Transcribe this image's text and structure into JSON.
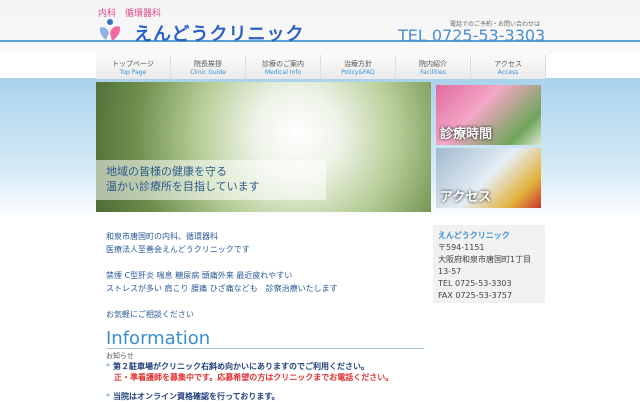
{
  "header": {
    "subtitle": "内科　循環器科",
    "clinic_name": "えんどうクリニック",
    "tel_note": "電話でのご予約・お問い合わせは",
    "tel": "TEL 0725-53-3303"
  },
  "nav": [
    {
      "ja": "トップページ",
      "en": "Top Page"
    },
    {
      "ja": "院長挨拶",
      "en": "Clinic Guide"
    },
    {
      "ja": "診療のご案内",
      "en": "Medical Info"
    },
    {
      "ja": "治療方針",
      "en": "Policy&FAQ"
    },
    {
      "ja": "院内紹介",
      "en": "Facilities"
    },
    {
      "ja": "アクセス",
      "en": "Access"
    }
  ],
  "hero": {
    "line1": "地域の皆様の健康を守る",
    "line2": "温かい診療所を目指しています"
  },
  "banners": {
    "hours": "診療時間",
    "access": "アクセス"
  },
  "intro": [
    "和泉市唐国町の内科、循環器科",
    "医療法人至善会えんどうクリニックです",
    "",
    "禁煙 C型肝炎 喘息 糖尿病 頭痛外来 最近疲れやすい",
    "ストレスが多い 肩こり 腰痛 ひざ痛なども　診察治療いたします",
    "",
    "お気軽にご相談ください"
  ],
  "sidebar": {
    "title": "えんどうクリニック",
    "zip": "〒594-1151",
    "addr1": "大阪府和泉市唐国町1丁目",
    "addr2": "13-57",
    "tel": "TEL 0725-53-3303",
    "fax": "FAX 0725-53-3757"
  },
  "info": {
    "heading": "Information",
    "subheading": "お知らせ",
    "items": [
      {
        "text": "第２駐車場がクリニック右斜め向かいにありますのでご利用ください。",
        "red": "正・準看護師を募集中です。応募希望の方はクリニックまでお電話ください。"
      },
      {
        "text": "当院はオンライン資格確認を行っております。"
      }
    ]
  }
}
